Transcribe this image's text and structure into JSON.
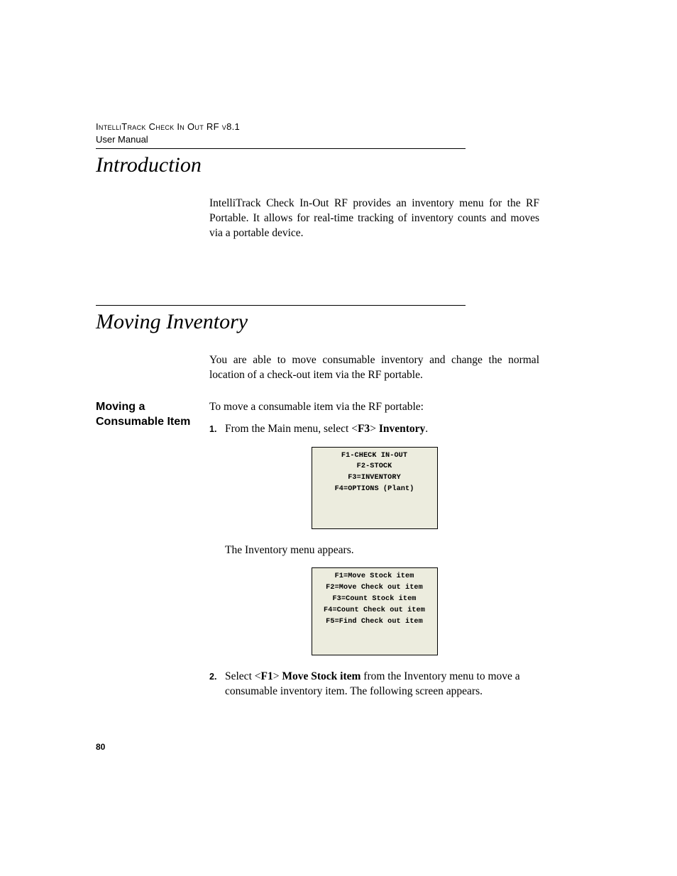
{
  "runningHead": {
    "line1": "IntelliTrack Check In Out RF v8.1",
    "line2": "User Manual"
  },
  "sections": {
    "intro": {
      "title": "Introduction",
      "para": "IntelliTrack Check In-Out RF provides an inventory menu for the RF Portable. It allows for real-time tracking of inventory counts and moves via a portable device."
    },
    "moving": {
      "title": "Moving Inventory",
      "para": "You are able to move consumable inventory and change the normal location of a check-out item via the RF portable."
    }
  },
  "sideHead": "Moving a Consumable Item",
  "lead": "To move a consumable item via the RF portable:",
  "step1": {
    "num": "1.",
    "pre": "From the Main menu, select <",
    "key": "F3",
    "mid": "> ",
    "bold": "Inventory",
    "post": "."
  },
  "screen1": {
    "l1": "F1-CHECK IN-OUT",
    "l2": "F2-STOCK",
    "l3": "F3=INVENTORY",
    "l4": "F4=OPTIONS (Plant)"
  },
  "interpara": "The Inventory menu appears.",
  "screen2": {
    "l1": "F1=Move Stock item",
    "l2": "F2=Move Check out item",
    "l3": "F3=Count Stock item",
    "l4": "F4=Count Check out item",
    "l5": "F5=Find Check out item"
  },
  "step2": {
    "num": "2.",
    "pre": "Select <",
    "key": "F1",
    "mid": "> ",
    "bold": "Move Stock item",
    "post": " from the Inventory menu to move a consumable inventory item. The following screen appears."
  },
  "pageNumber": "80"
}
